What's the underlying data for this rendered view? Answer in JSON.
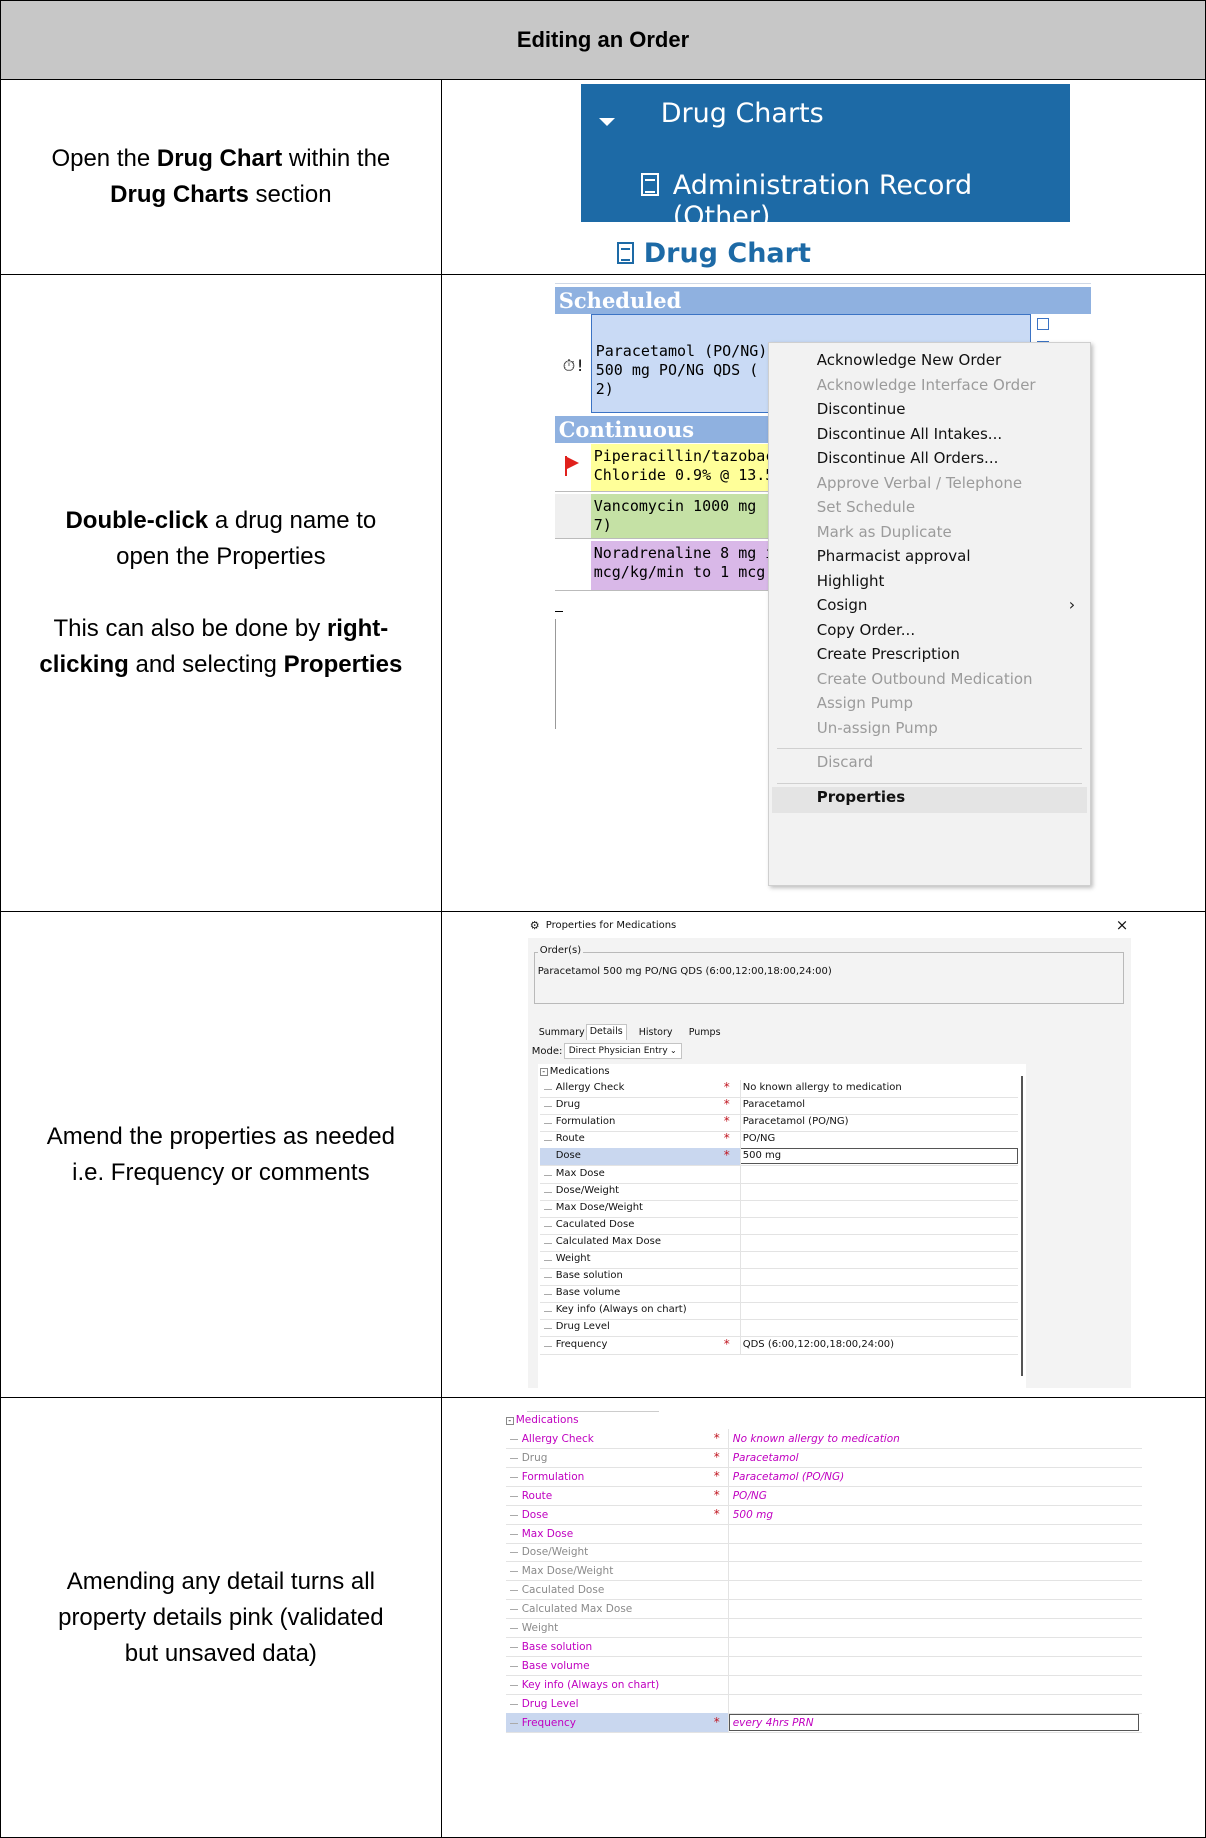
{
  "title": "Editing an Order",
  "steps": [
    {
      "instruction": [
        [
          {
            "t": "Open the "
          },
          {
            "t": "Drug Chart",
            "b": true
          },
          {
            "t": " within the"
          }
        ],
        [
          {
            "t": "Drug Charts",
            "b": true
          },
          {
            "t": " section"
          }
        ]
      ]
    },
    {
      "instruction": [
        [
          {
            "t": "Double-click",
            "b": true
          },
          {
            "t": " a drug name to"
          }
        ],
        [
          {
            "t": "open the Properties"
          }
        ],
        [],
        [
          {
            "t": "This can also be done by "
          },
          {
            "t": "right-",
            "b": true
          }
        ],
        [
          {
            "t": "clicking",
            "b": true
          },
          {
            "t": " and selecting "
          },
          {
            "t": "Properties",
            "b": true
          }
        ]
      ]
    },
    {
      "instruction": [
        [
          {
            "t": "Amend the properties as needed"
          }
        ],
        [
          {
            "t": "i.e. Frequency or comments"
          }
        ]
      ]
    },
    {
      "instruction": [
        [
          {
            "t": "Amending any detail turns all"
          }
        ],
        [
          {
            "t": "property details pink (validated"
          }
        ],
        [
          {
            "t": "but unsaved data)"
          }
        ]
      ]
    }
  ],
  "nav": {
    "section_label": "Drug Charts",
    "sub_item_label": "Administration Record (Other)",
    "link_label": "Drug Chart",
    "colors": {
      "nav_bg": "#1d6aa6",
      "link": "#1d6aa6"
    }
  },
  "drug_chart": {
    "scheduled_header": "Scheduled",
    "continuous_header": "Continuous",
    "scheduled_order": [
      "Paracetamol (PO/NG)",
      "500 mg PO/NG QDS (",
      "2)"
    ],
    "continuous_orders": [
      {
        "lines": [
          "Piperacillin/tazobacta",
          "Chloride 0.9% @ 13.5"
        ],
        "color": "#ffff99",
        "icon": "red-flag-icon"
      },
      {
        "lines": [
          "Vancomycin 1000 mg",
          "7)"
        ],
        "color": "#c5e1a5",
        "icon": ""
      },
      {
        "lines": [
          "Noradrenaline 8 mg i",
          "mcg/kg/min to 1 mcg"
        ],
        "color": "#d9b8e8",
        "icon": ""
      }
    ],
    "context_menu": [
      {
        "label": "Acknowledge New Order",
        "enabled": true
      },
      {
        "label": "Acknowledge Interface Order",
        "enabled": false
      },
      {
        "label": "Discontinue",
        "enabled": true
      },
      {
        "label": "Discontinue All Intakes...",
        "enabled": true
      },
      {
        "label": "Discontinue All Orders...",
        "enabled": true
      },
      {
        "label": "Approve Verbal / Telephone",
        "enabled": false
      },
      {
        "label": "Set Schedule",
        "enabled": false
      },
      {
        "label": "Mark as Duplicate",
        "enabled": false
      },
      {
        "label": "Pharmacist approval",
        "enabled": true
      },
      {
        "label": "Highlight",
        "enabled": true
      },
      {
        "label": "Cosign",
        "enabled": true,
        "submenu": true
      },
      {
        "label": "Copy Order...",
        "enabled": true
      },
      {
        "label": "Create Prescription",
        "enabled": true
      },
      {
        "label": "Create Outbound Medication",
        "enabled": false
      },
      {
        "label": "Assign Pump",
        "enabled": false
      },
      {
        "label": "Un-assign Pump",
        "enabled": false
      },
      {
        "label": "Discard",
        "enabled": false,
        "separator_before": true
      },
      {
        "label": "Properties",
        "enabled": true,
        "bold": true,
        "separator_before": true,
        "highlighted": true
      }
    ]
  },
  "properties": {
    "window_title": "Properties for Medications",
    "order_group_label": "Order(s)",
    "order_text": "Paracetamol 500 mg PO/NG QDS (6:00,12:00,18:00,24:00)",
    "tabs": [
      "Summary",
      "Details",
      "History",
      "Pumps"
    ],
    "active_tab": "Details",
    "mode_label": "Mode:",
    "mode_value": "Direct Physician Entry",
    "group_label": "Medications",
    "rows": [
      {
        "label": "Allergy Check",
        "required": true,
        "value": "No known allergy to medication"
      },
      {
        "label": "Drug",
        "required": true,
        "value": "Paracetamol"
      },
      {
        "label": "Formulation",
        "required": true,
        "value": "Paracetamol (PO/NG)"
      },
      {
        "label": "Route",
        "required": true,
        "value": "PO/NG"
      },
      {
        "label": "Dose",
        "required": true,
        "value": "500 mg",
        "selected": true
      },
      {
        "label": "Max Dose",
        "required": false,
        "value": ""
      },
      {
        "label": "Dose/Weight",
        "required": false,
        "value": ""
      },
      {
        "label": "Max Dose/Weight",
        "required": false,
        "value": ""
      },
      {
        "label": "Caculated Dose",
        "required": false,
        "value": ""
      },
      {
        "label": "Calculated Max Dose",
        "required": false,
        "value": ""
      },
      {
        "label": "Weight",
        "required": false,
        "value": ""
      },
      {
        "label": "Base solution",
        "required": false,
        "value": ""
      },
      {
        "label": "Base volume",
        "required": false,
        "value": ""
      },
      {
        "label": "Key info (Always on chart)",
        "required": false,
        "value": ""
      },
      {
        "label": "Drug Level",
        "required": false,
        "value": ""
      },
      {
        "label": "Frequency",
        "required": true,
        "value": "QDS (6:00,12:00,18:00,24:00)"
      }
    ]
  },
  "pink_properties": {
    "group_label": "Medications",
    "colors": {
      "pink": "#c000c0",
      "grey": "#8a8a8a",
      "star": "#c0141f"
    },
    "rows": [
      {
        "label": "Allergy Check",
        "pink": true,
        "required": true,
        "value": "No known allergy to medication"
      },
      {
        "label": "Drug",
        "pink": false,
        "required": true,
        "value": "Paracetamol"
      },
      {
        "label": "Formulation",
        "pink": true,
        "required": true,
        "value": "Paracetamol (PO/NG)"
      },
      {
        "label": "Route",
        "pink": true,
        "required": true,
        "value": "PO/NG"
      },
      {
        "label": "Dose",
        "pink": true,
        "required": true,
        "value": "500 mg"
      },
      {
        "label": "Max Dose",
        "pink": true,
        "required": false,
        "value": ""
      },
      {
        "label": "Dose/Weight",
        "pink": false,
        "required": false,
        "value": ""
      },
      {
        "label": "Max Dose/Weight",
        "pink": false,
        "required": false,
        "value": ""
      },
      {
        "label": "Caculated Dose",
        "pink": false,
        "required": false,
        "value": ""
      },
      {
        "label": "Calculated Max Dose",
        "pink": false,
        "required": false,
        "value": ""
      },
      {
        "label": "Weight",
        "pink": false,
        "required": false,
        "value": ""
      },
      {
        "label": "Base solution",
        "pink": true,
        "required": false,
        "value": ""
      },
      {
        "label": "Base volume",
        "pink": true,
        "required": false,
        "value": ""
      },
      {
        "label": "Key info (Always on chart)",
        "pink": true,
        "required": false,
        "value": ""
      },
      {
        "label": "Drug Level",
        "pink": true,
        "required": false,
        "value": ""
      },
      {
        "label": "Frequency",
        "pink": true,
        "required": true,
        "value": "every 4hrs PRN",
        "selected": true
      }
    ]
  }
}
